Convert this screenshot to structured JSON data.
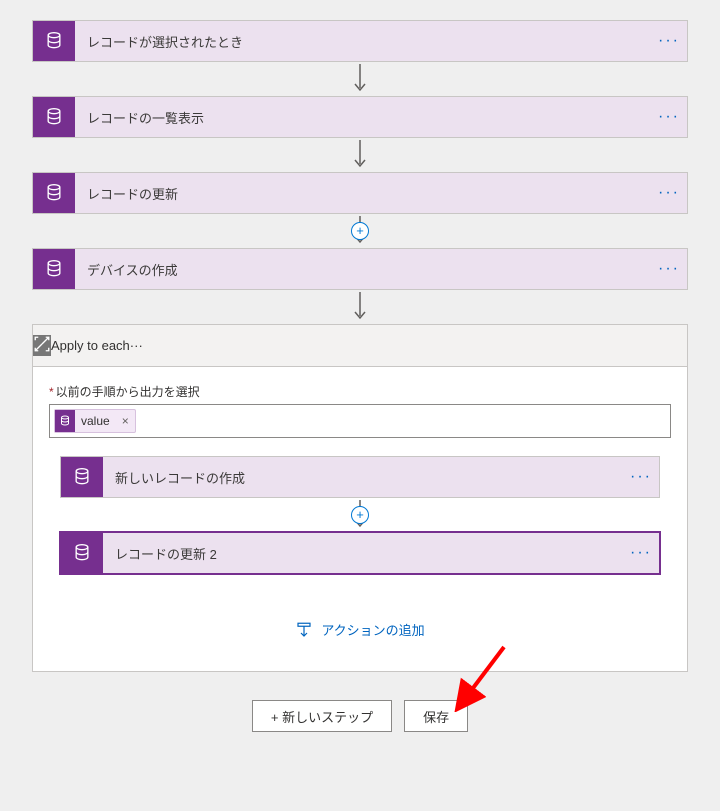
{
  "steps": [
    {
      "label": "レコードが選択されたとき"
    },
    {
      "label": "レコードの一覧表示"
    },
    {
      "label": "レコードの更新"
    },
    {
      "label": "デバイスの作成"
    }
  ],
  "foreach": {
    "header_label": "Apply to each",
    "field_label": "以前の手順から出力を選択",
    "token_label": "value",
    "inner_steps": [
      {
        "label": "新しいレコードの作成"
      },
      {
        "label": "レコードの更新 2"
      }
    ],
    "add_action_label": "アクションの追加"
  },
  "footer": {
    "new_step": "+ 新しいステップ",
    "save": "保存"
  }
}
